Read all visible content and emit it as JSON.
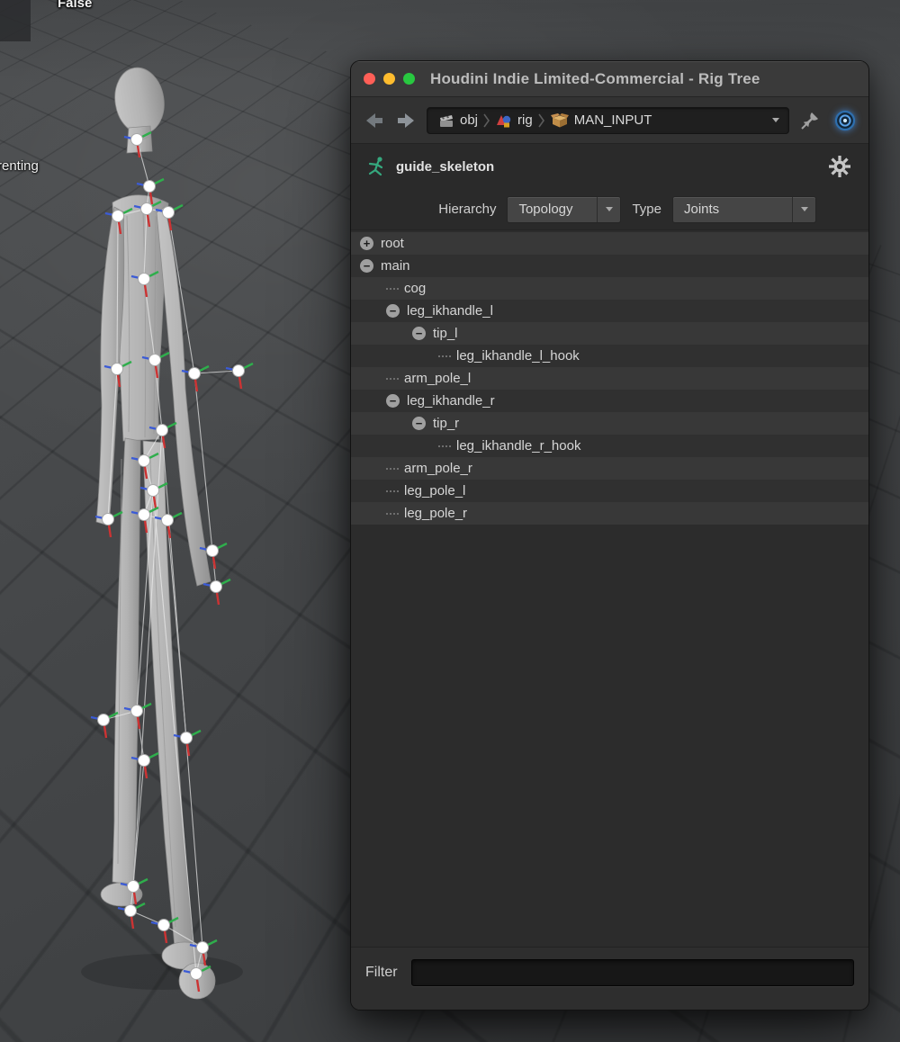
{
  "viewport": {
    "overlay_top": "False",
    "overlay_left": "renting"
  },
  "window": {
    "title": "Houdini Indie Limited-Commercial - Rig Tree",
    "breadcrumb": {
      "segments": [
        {
          "label": "obj",
          "icon": "scene-icon"
        },
        {
          "label": "rig",
          "icon": "geometry-icon"
        },
        {
          "label": "MAN_INPUT",
          "icon": "box-icon"
        }
      ]
    },
    "node": {
      "name": "guide_skeleton"
    },
    "controls": {
      "hierarchy_label": "Hierarchy",
      "hierarchy_value": "Topology",
      "type_label": "Type",
      "type_value": "Joints"
    },
    "tree": [
      {
        "label": "root",
        "depth": 0,
        "expander": "plus"
      },
      {
        "label": "main",
        "depth": 0,
        "expander": "minus"
      },
      {
        "label": "cog",
        "depth": 1,
        "expander": "none"
      },
      {
        "label": "leg_ikhandle_l",
        "depth": 1,
        "expander": "minus"
      },
      {
        "label": "tip_l",
        "depth": 2,
        "expander": "minus"
      },
      {
        "label": "leg_ikhandle_l_hook",
        "depth": 3,
        "expander": "none"
      },
      {
        "label": "arm_pole_l",
        "depth": 1,
        "expander": "none"
      },
      {
        "label": "leg_ikhandle_r",
        "depth": 1,
        "expander": "minus"
      },
      {
        "label": "tip_r",
        "depth": 2,
        "expander": "minus"
      },
      {
        "label": "leg_ikhandle_r_hook",
        "depth": 3,
        "expander": "none"
      },
      {
        "label": "arm_pole_r",
        "depth": 1,
        "expander": "none"
      },
      {
        "label": "leg_pole_l",
        "depth": 1,
        "expander": "none"
      },
      {
        "label": "leg_pole_r",
        "depth": 1,
        "expander": "none"
      }
    ],
    "filter": {
      "label": "Filter",
      "value": ""
    }
  },
  "colors": {
    "close_red": "#ff5f57",
    "minimize_yellow": "#febc2e",
    "zoom_green": "#28c840",
    "accent_blue": "#4a8fd4",
    "axis_red": "#cc3333",
    "axis_green": "#2fae4c",
    "axis_blue": "#3b5bd6"
  }
}
